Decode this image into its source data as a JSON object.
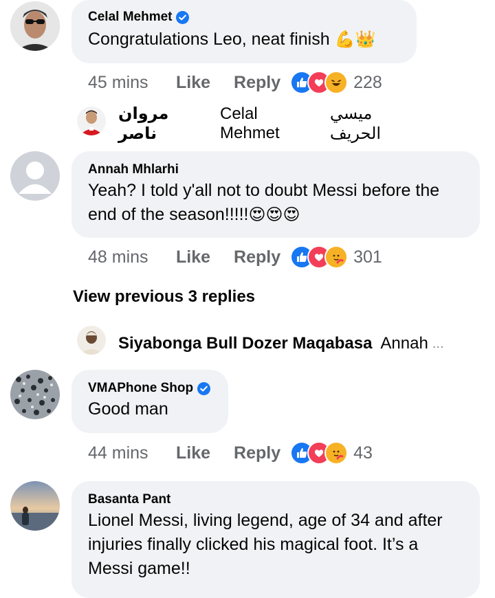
{
  "comments": [
    {
      "author": "Celal Mehmet",
      "verified": true,
      "text": "Congratulations Leo, neat finish",
      "emojis": "💪👑",
      "time": "45 mins",
      "like_label": "Like",
      "reply_label": "Reply",
      "reaction_count": "228",
      "reply_preview": {
        "author": "مروان ناصر",
        "mention": "Celal Mehmet",
        "text": "ميسي الحريف"
      }
    },
    {
      "author": "Annah Mhlarhi",
      "verified": false,
      "text_line1": "Yeah? I told y'all not to doubt Messi before the",
      "text_line2": "end of the season!!!!!",
      "emojis": "😍😍😍",
      "time": "48 mins",
      "like_label": "Like",
      "reply_label": "Reply",
      "reaction_count": "301",
      "view_previous": "View previous 3 replies",
      "reply_preview": {
        "author": "Siyabonga Bull Dozer Maqabasa",
        "text": "Annah",
        "ellipsis": "..."
      }
    },
    {
      "author": "VMAPhone Shop",
      "verified": true,
      "text": "Good man",
      "time": "44 mins",
      "like_label": "Like",
      "reply_label": "Reply",
      "reaction_count": "43"
    },
    {
      "author": "Basanta Pant",
      "verified": false,
      "text_line1": "Lionel Messi, living legend, age of 34 and after",
      "text_line2": "injuries finally clicked his magical foot. It’s a",
      "text_line3": "Messi game!!"
    }
  ],
  "icons": {
    "like": "like-icon",
    "love": "love-icon",
    "haha": "haha-icon",
    "care": "care-icon",
    "verified": "verified-badge-icon"
  },
  "colors": {
    "like_blue": "#1877f2",
    "love_red": "#f33e58",
    "bubble": "#f0f2f5",
    "meta_gray": "#65676b",
    "emoji_yellow": "#f7b125"
  }
}
